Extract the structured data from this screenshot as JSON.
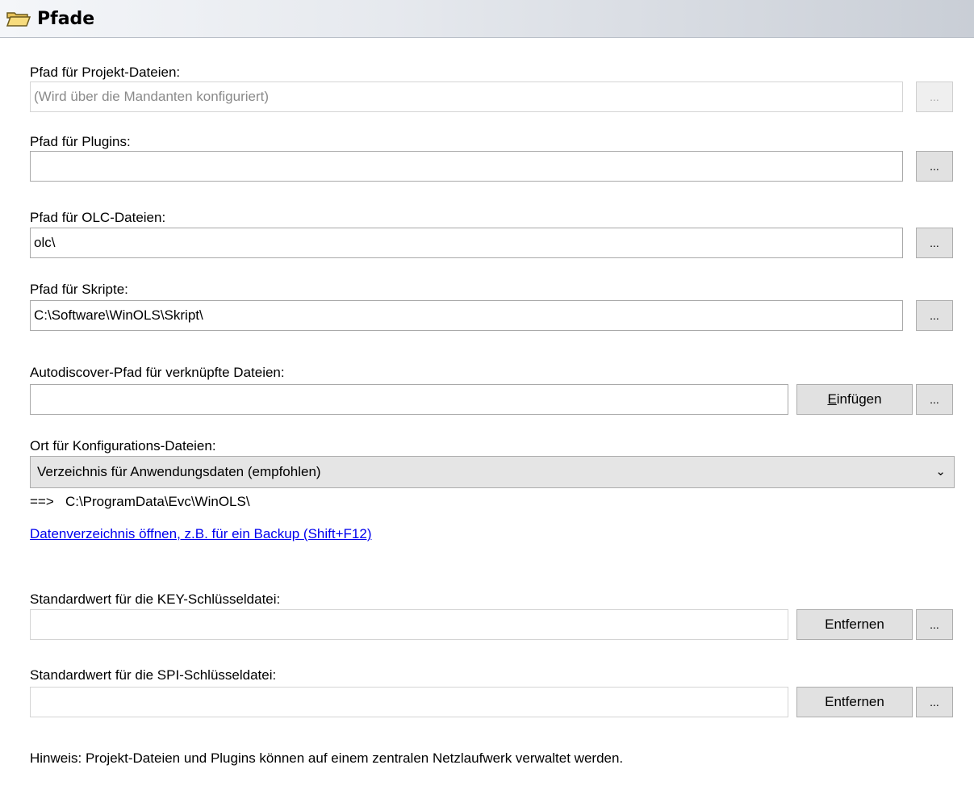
{
  "header": {
    "title": "Pfade",
    "icon": "folder-open-icon"
  },
  "fields": {
    "project": {
      "label": "Pfad für Projekt-Dateien:",
      "value": "(Wird über die Mandanten konfiguriert)"
    },
    "plugins": {
      "label": "Pfad für Plugins:",
      "value": ""
    },
    "olc": {
      "label": "Pfad für OLC-Dateien:",
      "value": "olc\\"
    },
    "scripts": {
      "label": "Pfad für Skripte:",
      "value": "C:\\Software\\WinOLS\\Skript\\"
    },
    "autodiscover": {
      "label": "Autodiscover-Pfad für verknüpfte Dateien:",
      "value": "",
      "insert_button_first": "E",
      "insert_button_rest": "infügen"
    },
    "config": {
      "label": "Ort für Konfigurations-Dateien:",
      "selected": "Verzeichnis für Anwendungsdaten (empfohlen)",
      "resolved": "==>   C:\\ProgramData\\Evc\\WinOLS\\"
    },
    "key": {
      "label": "Standardwert für die KEY-Schlüsseldatei:",
      "value": "",
      "remove_button": "Entfernen"
    },
    "spi": {
      "label": "Standardwert für die SPI-Schlüsseldatei:",
      "value": "",
      "remove_button": "Entfernen"
    }
  },
  "browse_label": "...",
  "open_data_dir_link": "Datenverzeichnis öffnen, z.B. für ein Backup (Shift+F12)",
  "hint": "Hinweis: Projekt-Dateien und Plugins können auf einem zentralen Netzlaufwerk verwaltet werden."
}
